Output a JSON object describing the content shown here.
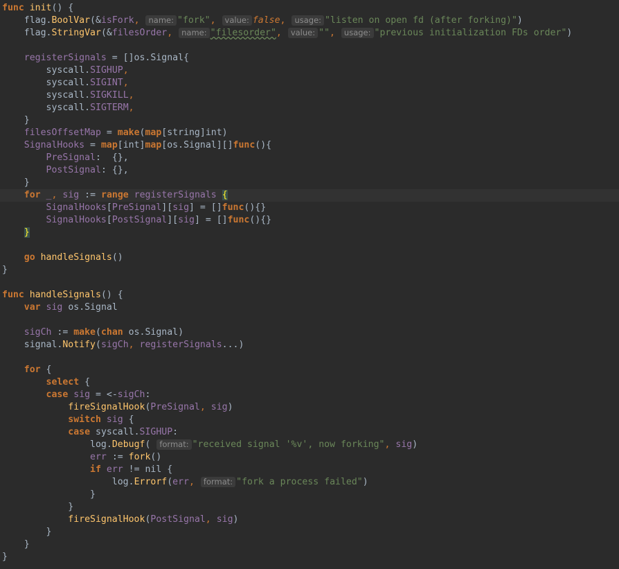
{
  "editor": {
    "line_count": 45,
    "current_line": 16
  },
  "code": {
    "l1_kw": "func",
    "l1_name": "init",
    "l1_rest": "() {",
    "l2_pre": "    flag.",
    "l2_call": "BoolVar",
    "l2_open": "(&",
    "l2_arg": "isFork",
    "l2_comma": ",",
    "hint_name": "name:",
    "hint_value": "value:",
    "hint_usage": "usage:",
    "hint_format": "format:",
    "l2_name": "\"fork\"",
    "l2_value": "false",
    "l2_usage": "\"listen on open fd (after forking)\"",
    "l2_close": ")",
    "l3_call": "StringVar",
    "l3_arg": "filesOrder",
    "l3_name": "\"filesorder\"",
    "l3_value": "\"\"",
    "l3_usage": "\"previous initialization FDs order\"",
    "l5_var": "registerSignals",
    "l5_rest": " = []os.",
    "l5_type": "Signal",
    "l5_brace": "{",
    "sig_pkg": "syscall.",
    "sig1": "SIGHUP",
    "sig2": "SIGINT",
    "sig3": "SIGKILL",
    "sig4": "SIGTERM",
    "close_brace": "}",
    "l11_var": "filesOffsetMap",
    "l11_eq": " = ",
    "make": "make",
    "map": "map",
    "l11_rest": "[string]int)",
    "l12_var": "SignalHooks",
    "l12_int": "[int]",
    "l12_os": "[os.",
    "l12_type": "Signal",
    "l12_rest": "][]",
    "func": "func",
    "l12_end": "(){",
    "l13_key": "PreSignal",
    "l13_val": ":  {},",
    "l14_key": "PostSignal",
    "l14_val": ": {},",
    "for": "for",
    "l16_blank": "_",
    "l16_sig": "sig",
    "l16_assign": " := ",
    "range": "range",
    "l16_src": "registerSignals",
    "l17_hooks": "SignalHooks",
    "l17_pre": "PreSignal",
    "l18_post": "PostSignal",
    "l17_tail": "] = []",
    "l17_end": "(){}",
    "go": "go",
    "handle": "handleSignals",
    "parens": "()",
    "l23_name": "handleSignals",
    "var": "var",
    "l24_sig": "sig",
    "l24_type": " os.",
    "l24_signal": "Signal",
    "l26_var": "sigCh",
    "chan": "chan",
    "l26_rest": " os.",
    "l27_pre": "signal.",
    "l27_call": "Notify",
    "l27_arg1": "sigCh",
    "l27_arg2": "registerSignals",
    "l27_end": "...)",
    "select": "select",
    "case": "case",
    "switch": "switch",
    "l31_rest": " = <-",
    "l32_call": "fireSignalHook",
    "l32_arg": "PreSignal",
    "l35_log": "log.",
    "l35_call": "Debugf",
    "l35_str": "\"received signal '%v', now forking\"",
    "l36_err": "err",
    "l36_call": "fork",
    "if": "if",
    "l37_rest": " != nil {",
    "l38_call": "Errorf",
    "l38_str": "\"fork a process failed\"",
    "l41_arg": "PostSignal"
  }
}
